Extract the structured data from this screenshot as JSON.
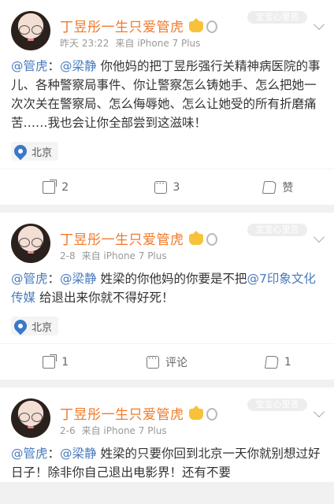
{
  "posts": [
    {
      "author": "丁昱彤一生只爱管虎",
      "time": "昨天 23:22",
      "source": "来自 iPhone 7 Plus",
      "mention1": "@管虎",
      "sep": "：",
      "mention2": "@梁静",
      "text_a": " 你他妈的把丁昱彤强行关精神病医院的事儿、各种警察局事件、你让警察怎么铸她手、怎么把她一次次关在警察局、怎么侮辱她、怎么让她受的所有折磨痛苦……我也会让你全部尝到这滋味！",
      "mention3": "",
      "text_b": "",
      "location": "北京",
      "share": "2",
      "comment": "3",
      "like": "赞"
    },
    {
      "author": "丁昱彤一生只爱管虎",
      "time": "2-8",
      "source": "来自 iPhone 7 Plus",
      "mention1": "@管虎",
      "sep": "：",
      "mention2": "@梁静",
      "text_a": " 姓梁的你他妈的你要是不把",
      "mention3": "@7印象文化传媒",
      "text_b": " 给退出来你就不得好死！",
      "location": "北京",
      "share": "1",
      "comment": "评论",
      "like": "1"
    },
    {
      "author": "丁昱彤一生只爱管虎",
      "time": "2-6",
      "source": "来自 iPhone 7 Plus",
      "mention1": "@管虎",
      "sep": "：",
      "mention2": "@梁静",
      "text_a": " 姓梁的只要你回到北京一天你就别想过好日子！除非你自己退出电影界！还有不要",
      "mention3": "",
      "text_b": ""
    }
  ],
  "watermark": "宝宝心里苦",
  "icons": {
    "share": "share-icon",
    "comment": "comment-icon",
    "like": "like-icon",
    "location": "location-pin-icon"
  },
  "colors": {
    "author": "#f07a2b",
    "mention": "#4a7bbf",
    "meta": "#999999"
  }
}
